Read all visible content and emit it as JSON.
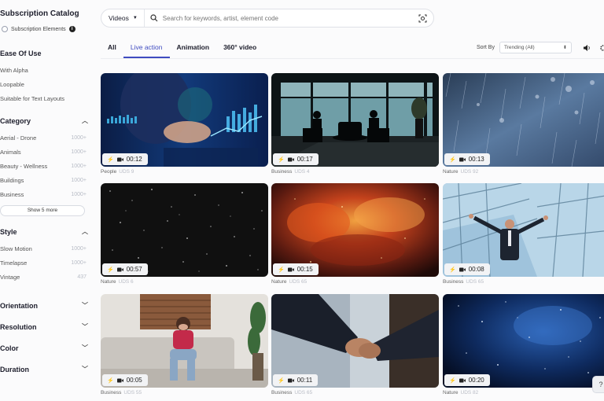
{
  "sidebar": {
    "title": "Subscription Catalog",
    "toggle_label": "Subscription Elements",
    "info": "i",
    "ease_of_use": {
      "title": "Ease Of Use",
      "items": [
        "With Alpha",
        "Loopable",
        "Suitable for Text Layouts"
      ]
    },
    "category": {
      "title": "Category",
      "items": [
        {
          "label": "Aerial - Drone",
          "count": "1000+"
        },
        {
          "label": "Animals",
          "count": "1000+"
        },
        {
          "label": "Beauty - Wellness",
          "count": "1000+"
        },
        {
          "label": "Buildings",
          "count": "1000+"
        },
        {
          "label": "Business",
          "count": "1000+"
        }
      ],
      "show_more": "Show 5 more"
    },
    "style": {
      "title": "Style",
      "items": [
        {
          "label": "Slow Motion",
          "count": "1000+"
        },
        {
          "label": "Timelapse",
          "count": "1000+"
        },
        {
          "label": "Vintage",
          "count": "437"
        }
      ]
    },
    "collapsed": [
      "Orientation",
      "Resolution",
      "Color",
      "Duration"
    ]
  },
  "search": {
    "type": "Videos",
    "placeholder": "Search for keywords, artist, element code"
  },
  "tabs": [
    "All",
    "Live action",
    "Animation",
    "360° video"
  ],
  "active_tab": "Live action",
  "sort": {
    "label": "Sort By",
    "value": "Trending (All)"
  },
  "cards": [
    {
      "duration": "00:12",
      "category": "People",
      "code": "UDS 9"
    },
    {
      "duration": "00:17",
      "category": "Business",
      "code": "UDS 4"
    },
    {
      "duration": "00:13",
      "category": "Nature",
      "code": "UDS 92"
    },
    {
      "duration": "00:57",
      "category": "Nature",
      "code": "UDS 6"
    },
    {
      "duration": "00:15",
      "category": "Nature",
      "code": "UDS 65"
    },
    {
      "duration": "00:08",
      "category": "Business",
      "code": "UDS 65"
    },
    {
      "duration": "00:05",
      "category": "Business",
      "code": "UDS 55"
    },
    {
      "duration": "00:11",
      "category": "Business",
      "code": "UDS 65"
    },
    {
      "duration": "00:20",
      "category": "Nature",
      "code": "UDS 82"
    }
  ],
  "help": "?",
  "colors": {
    "accent": "#3f4bc0",
    "text": "#1c1d2b"
  }
}
